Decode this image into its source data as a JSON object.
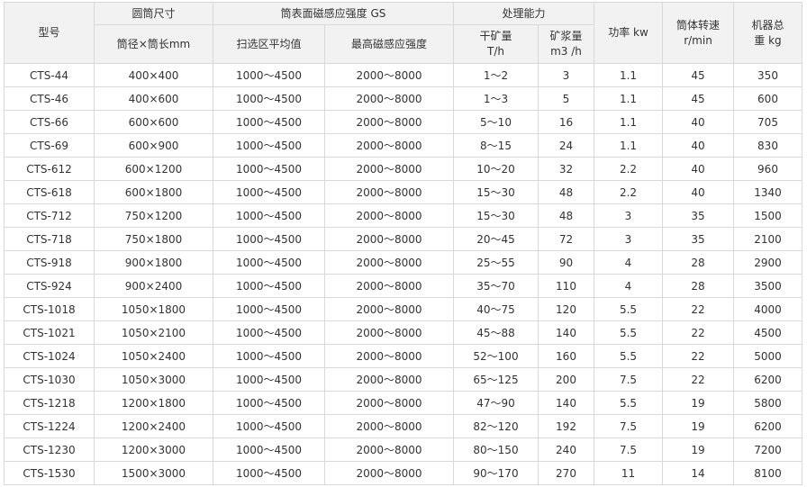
{
  "table": {
    "headers": {
      "model": "型号",
      "drum_size": "圆筒尺寸",
      "drum_size_sub": "筒径×筒长mm",
      "field": "筒表面磁感应强度 GS",
      "field_avg": "扫选区平均值",
      "field_max": "最高磁感应强度",
      "capacity": "处理能力",
      "dry_line1": "干矿量",
      "dry_line2": "T/h",
      "slurry_line1": "矿浆量",
      "slurry_line2": "m3 /h",
      "power": "功率 kw",
      "speed_line1": "筒体转速",
      "speed_line2": "r/min",
      "weight_line1": "机器总",
      "weight_line2": "重 kg"
    },
    "rows": [
      [
        "CTS-44",
        "400×400",
        "1000～4500",
        "2000～8000",
        "1～2",
        "3",
        "1.1",
        "45",
        "350"
      ],
      [
        "CTS-46",
        "400×600",
        "1000～4500",
        "2000～8000",
        "1～3",
        "5",
        "1.1",
        "45",
        "600"
      ],
      [
        "CTS-66",
        "600×600",
        "1000～4500",
        "2000～8000",
        "5～10",
        "16",
        "1.1",
        "40",
        "705"
      ],
      [
        "CTS-69",
        "600×900",
        "1000～4500",
        "2000～8000",
        "8～15",
        "24",
        "1.1",
        "40",
        "830"
      ],
      [
        "CTS-612",
        "600×1200",
        "1000～4500",
        "2000～8000",
        "10～20",
        "32",
        "2.2",
        "40",
        "960"
      ],
      [
        "CTS-618",
        "600×1800",
        "1000～4500",
        "2000～8000",
        "15～30",
        "48",
        "2.2",
        "40",
        "1340"
      ],
      [
        "CTS-712",
        "750×1200",
        "1000～4500",
        "2000～8000",
        "15～30",
        "48",
        "3",
        "35",
        "1500"
      ],
      [
        "CTS-718",
        "750×1800",
        "1000～4500",
        "2000～8000",
        "20～45",
        "72",
        "3",
        "35",
        "2100"
      ],
      [
        "CTS-918",
        "900×1800",
        "1000～4500",
        "2000～8000",
        "25～55",
        "90",
        "4",
        "28",
        "2900"
      ],
      [
        "CTS-924",
        "900×2400",
        "1000～4500",
        "2000～8000",
        "35～70",
        "110",
        "4",
        "28",
        "3500"
      ],
      [
        "CTS-1018",
        "1050×1800",
        "1000～4500",
        "2000～8000",
        "40～75",
        "120",
        "5.5",
        "22",
        "4000"
      ],
      [
        "CTS-1021",
        "1050×2100",
        "1000～4500",
        "2000～8000",
        "45～88",
        "140",
        "5.5",
        "22",
        "4500"
      ],
      [
        "CTS-1024",
        "1050×2400",
        "1000～4500",
        "2000～8000",
        "52～100",
        "160",
        "5.5",
        "22",
        "5000"
      ],
      [
        "CTS-1030",
        "1050×3000",
        "1000～4500",
        "2000～8000",
        "65～125",
        "200",
        "7.5",
        "22",
        "6200"
      ],
      [
        "CTS-1218",
        "1200×1800",
        "1000～4500",
        "2000～8000",
        "47～90",
        "140",
        "5.5",
        "19",
        "5800"
      ],
      [
        "CTS-1224",
        "1200×2400",
        "1000～4500",
        "2000～8000",
        "82～120",
        "192",
        "7.5",
        "19",
        "6200"
      ],
      [
        "CTS-1230",
        "1200×3000",
        "1000～4500",
        "2000～8000",
        "80～150",
        "240",
        "7.5",
        "19",
        "7200"
      ],
      [
        "CTS-1530",
        "1500×3000",
        "1000～4500",
        "2000～8000",
        "90～170",
        "270",
        "11",
        "14",
        "8100"
      ]
    ]
  }
}
